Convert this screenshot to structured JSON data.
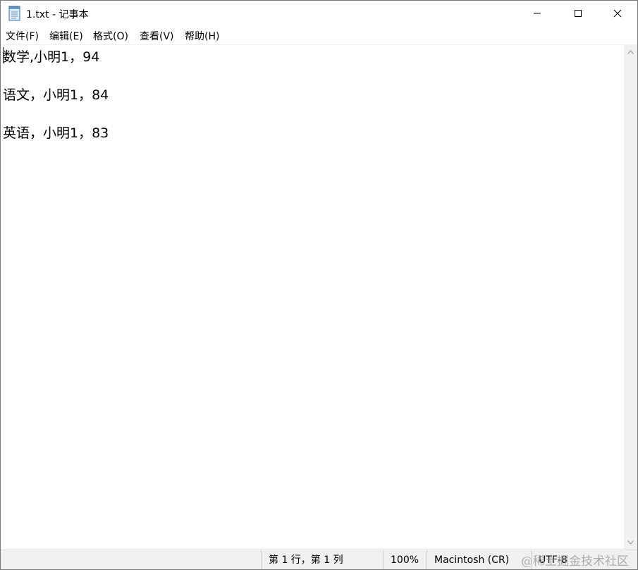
{
  "window": {
    "title": "1.txt - 记事本",
    "icon": "notepad-icon"
  },
  "menu": {
    "items": [
      "文件(F)",
      "编辑(E)",
      "格式(O)",
      "查看(V)",
      "帮助(H)"
    ]
  },
  "editor": {
    "lines": [
      "数学,小明1，94",
      "语文，小明1，84",
      "英语，小明1，83"
    ]
  },
  "status": {
    "position": "第 1 行，第 1 列",
    "zoom": "100%",
    "line_ending": "Macintosh (CR)",
    "encoding": "UTF-8"
  },
  "watermark": "@稀土掘金技术社区",
  "colors": {
    "statusbar_bg": "#f0f0f0",
    "scrollbar_bg": "#f0f0f0",
    "close_hover": "#e81123"
  }
}
